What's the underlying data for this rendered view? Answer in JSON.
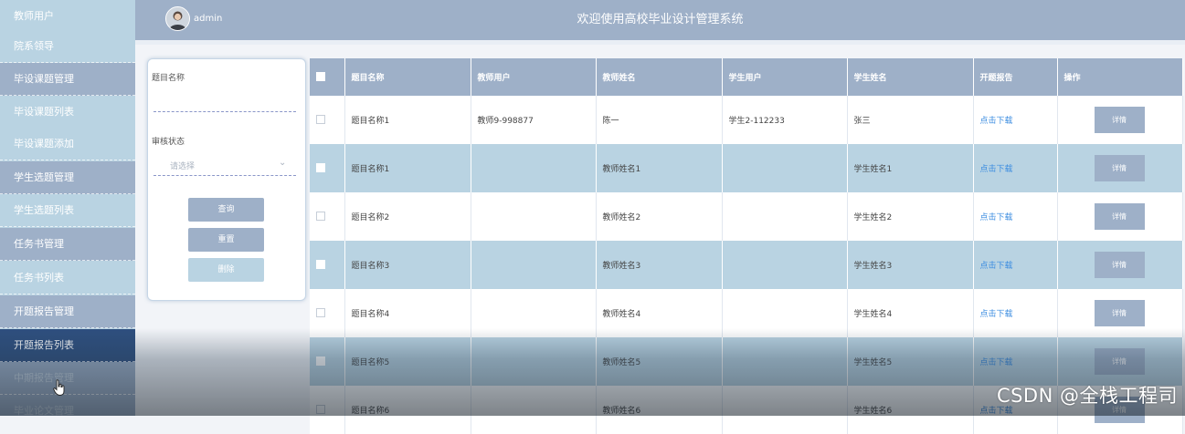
{
  "header": {
    "username": "admin",
    "site_title": "欢迎使用高校毕业设计管理系统"
  },
  "sidebar": {
    "items": [
      {
        "label": "教师用户"
      },
      {
        "label": "院系领导"
      },
      {
        "label": "毕设课题管理"
      },
      {
        "label": "毕设课题列表"
      },
      {
        "label": "毕设课题添加"
      },
      {
        "label": "学生选题管理"
      },
      {
        "label": "学生选题列表"
      },
      {
        "label": "任务书管理"
      },
      {
        "label": "任务书列表"
      },
      {
        "label": "开题报告管理"
      },
      {
        "label": "开题报告列表"
      },
      {
        "label": "中期报告管理"
      },
      {
        "label": "毕业论文管理"
      }
    ],
    "active_index": 10
  },
  "search": {
    "title_label": "题目名称",
    "title_value": "",
    "status_label": "审核状态",
    "status_placeholder": "请选择",
    "query_label": "查询",
    "reset_label": "重置",
    "delete_label": "删除"
  },
  "table": {
    "headers": [
      "题目名称",
      "教师用户",
      "教师姓名",
      "学生用户",
      "学生姓名",
      "开题报告",
      "操作"
    ],
    "rows": [
      {
        "title": "题目名称1",
        "teacher_user": "教师9-998877",
        "teacher_name": "陈一",
        "student_user": "学生2-112233",
        "student_name": "张三",
        "report": "点击下载",
        "action": "详情"
      },
      {
        "title": "题目名称1",
        "teacher_user": "",
        "teacher_name": "教师姓名1",
        "student_user": "",
        "student_name": "学生姓名1",
        "report": "点击下载",
        "action": "详情"
      },
      {
        "title": "题目名称2",
        "teacher_user": "",
        "teacher_name": "教师姓名2",
        "student_user": "",
        "student_name": "学生姓名2",
        "report": "点击下载",
        "action": "详情"
      },
      {
        "title": "题目名称3",
        "teacher_user": "",
        "teacher_name": "教师姓名3",
        "student_user": "",
        "student_name": "学生姓名3",
        "report": "点击下载",
        "action": "详情"
      },
      {
        "title": "题目名称4",
        "teacher_user": "",
        "teacher_name": "教师姓名4",
        "student_user": "",
        "student_name": "学生姓名4",
        "report": "点击下载",
        "action": "详情"
      },
      {
        "title": "题目名称5",
        "teacher_user": "",
        "teacher_name": "教师姓名5",
        "student_user": "",
        "student_name": "学生姓名5",
        "report": "点击下载",
        "action": "详情"
      },
      {
        "title": "题目名称6",
        "teacher_user": "",
        "teacher_name": "教师姓名6",
        "student_user": "",
        "student_name": "学生姓名6",
        "report": "点击下载",
        "action": "详情"
      }
    ]
  },
  "watermark": "CSDN @全栈工程司",
  "colors": {
    "sidebar_bg": "#b9d3e2",
    "group_bg": "#9eb0c8",
    "active_bg": "#2e4f7f",
    "link": "#3b8ce0"
  }
}
